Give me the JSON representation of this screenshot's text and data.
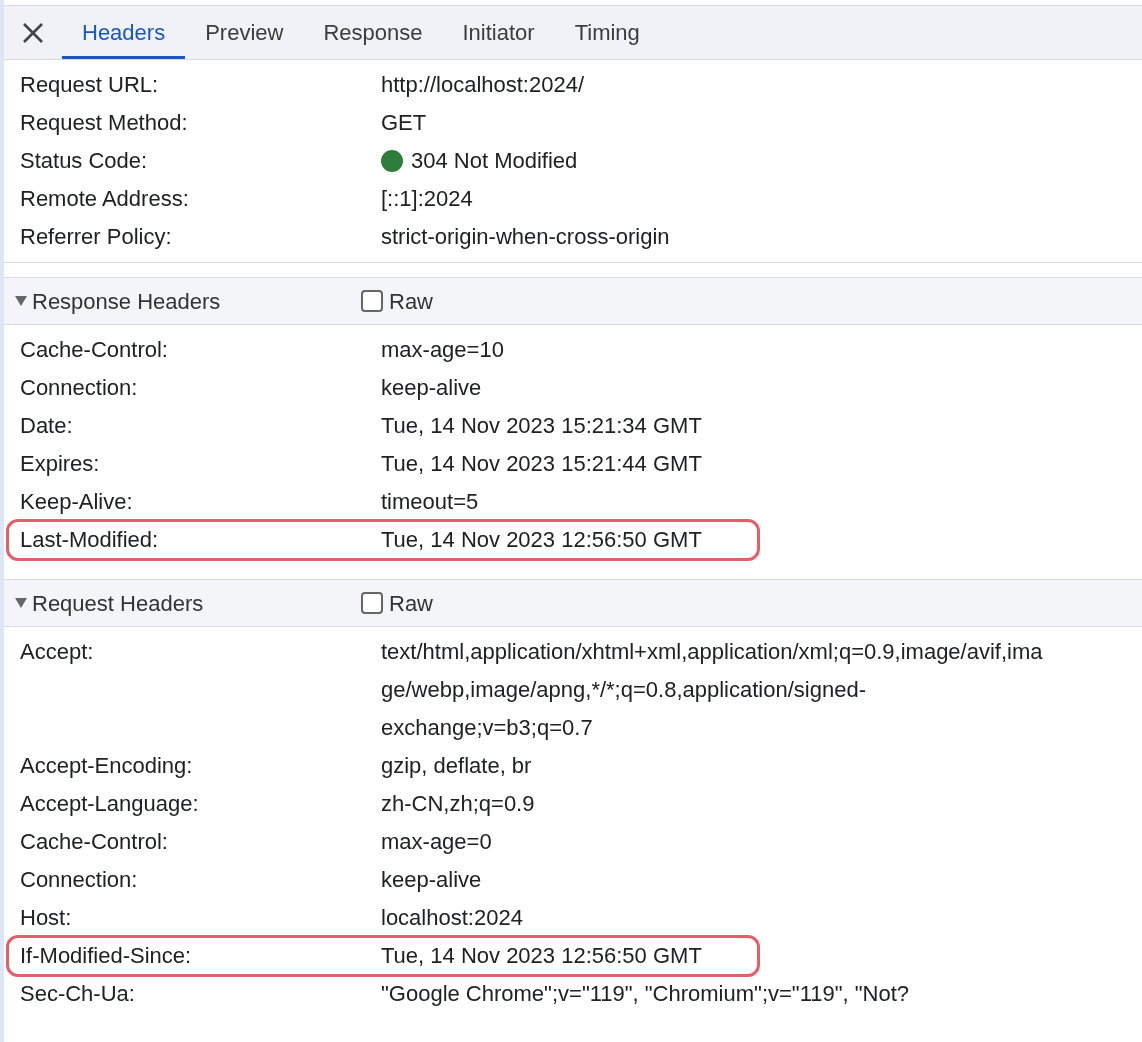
{
  "tabs": [
    {
      "label": "Headers",
      "selected": true
    },
    {
      "label": "Preview",
      "selected": false
    },
    {
      "label": "Response",
      "selected": false
    },
    {
      "label": "Initiator",
      "selected": false
    },
    {
      "label": "Timing",
      "selected": false
    }
  ],
  "general": {
    "rows": [
      {
        "name": "Request URL:",
        "value": "http://localhost:2024/"
      },
      {
        "name": "Request Method:",
        "value": "GET"
      },
      {
        "name": "Status Code:",
        "value": "304 Not Modified",
        "kind": "status"
      },
      {
        "name": "Remote Address:",
        "value": "[::1]:2024"
      },
      {
        "name": "Referrer Policy:",
        "value": "strict-origin-when-cross-origin"
      }
    ]
  },
  "sections": [
    {
      "title": "Response Headers",
      "expanded": true,
      "raw_label": "Raw",
      "raw_checked": false,
      "rows": [
        {
          "name": "Cache-Control:",
          "value": "max-age=10",
          "highlighted": false
        },
        {
          "name": "Connection:",
          "value": "keep-alive",
          "highlighted": false
        },
        {
          "name": "Date:",
          "value": "Tue, 14 Nov 2023 15:21:34 GMT",
          "highlighted": false
        },
        {
          "name": "Expires:",
          "value": "Tue, 14 Nov 2023 15:21:44 GMT",
          "highlighted": false
        },
        {
          "name": "Keep-Alive:",
          "value": "timeout=5",
          "highlighted": false
        },
        {
          "name": "Last-Modified:",
          "value": "Tue, 14 Nov 2023 12:56:50 GMT",
          "highlighted": true
        }
      ]
    },
    {
      "title": "Request Headers",
      "expanded": true,
      "raw_label": "Raw",
      "raw_checked": false,
      "rows": [
        {
          "name": "Accept:",
          "value": "text/html,application/xhtml+xml,application/xml;q=0.9,image/avif,image/webp,image/apng,*/*;q=0.8,application/signed-exchange;v=b3;q=0.7",
          "highlighted": false
        },
        {
          "name": "Accept-Encoding:",
          "value": "gzip, deflate, br",
          "highlighted": false
        },
        {
          "name": "Accept-Language:",
          "value": "zh-CN,zh;q=0.9",
          "highlighted": false
        },
        {
          "name": "Cache-Control:",
          "value": "max-age=0",
          "highlighted": false
        },
        {
          "name": "Connection:",
          "value": "keep-alive",
          "highlighted": false
        },
        {
          "name": "Host:",
          "value": "localhost:2024",
          "highlighted": false
        },
        {
          "name": "If-Modified-Since:",
          "value": "Tue, 14 Nov 2023 12:56:50 GMT",
          "highlighted": true
        },
        {
          "name": "Sec-Ch-Ua:",
          "value": "\"Google Chrome\";v=\"119\", \"Chromium\";v=\"119\", \"Not?",
          "highlighted": false
        }
      ]
    }
  ]
}
